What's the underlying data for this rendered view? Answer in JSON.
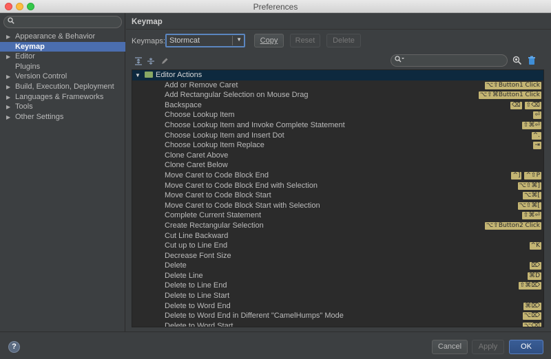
{
  "window": {
    "title": "Preferences"
  },
  "sidebar": {
    "items": [
      {
        "label": "Appearance & Behavior",
        "arrow": "▶",
        "selected": false,
        "child": false
      },
      {
        "label": "Keymap",
        "arrow": "",
        "selected": true,
        "child": true
      },
      {
        "label": "Editor",
        "arrow": "▶",
        "selected": false,
        "child": false
      },
      {
        "label": "Plugins",
        "arrow": "",
        "selected": false,
        "child": true
      },
      {
        "label": "Version Control",
        "arrow": "▶",
        "selected": false,
        "child": false
      },
      {
        "label": "Build, Execution, Deployment",
        "arrow": "▶",
        "selected": false,
        "child": false
      },
      {
        "label": "Languages & Frameworks",
        "arrow": "▶",
        "selected": false,
        "child": false
      },
      {
        "label": "Tools",
        "arrow": "▶",
        "selected": false,
        "child": false
      },
      {
        "label": "Other Settings",
        "arrow": "▶",
        "selected": false,
        "child": false
      }
    ]
  },
  "main": {
    "heading": "Keymap",
    "keymaps_label": "Keymaps:",
    "keymap_selected": "Stormcat",
    "copy_label": "Copy",
    "reset_label": "Reset",
    "delete_label": "Delete"
  },
  "icons": {
    "search": "search-icon",
    "expand_all": "expand-all-icon",
    "collapse_all": "collapse-all-icon",
    "edit": "pencil-icon",
    "find_shortcut": "find-shortcut-icon",
    "clear": "trash-icon",
    "help": "help-icon"
  },
  "tree": {
    "group": "Editor Actions",
    "rows": [
      {
        "name": "Add or Remove Caret",
        "keys": [
          "⌥⇧Button1 Click"
        ]
      },
      {
        "name": "Add Rectangular Selection on Mouse Drag",
        "keys": [
          "⌥⇧⌘Button1 Click"
        ]
      },
      {
        "name": "Backspace",
        "keys": [
          "⌫",
          "⇧⌫"
        ]
      },
      {
        "name": "Choose Lookup Item",
        "keys": [
          "⏎"
        ]
      },
      {
        "name": "Choose Lookup Item and Invoke Complete Statement",
        "keys": [
          "⇧⌘⏎"
        ]
      },
      {
        "name": "Choose Lookup Item and Insert Dot",
        "keys": [
          "^."
        ]
      },
      {
        "name": "Choose Lookup Item Replace",
        "keys": [
          "⇥"
        ]
      },
      {
        "name": "Clone Caret Above",
        "keys": []
      },
      {
        "name": "Clone Caret Below",
        "keys": []
      },
      {
        "name": "Move Caret to Code Block End",
        "keys": [
          "^]",
          "^⇧P"
        ]
      },
      {
        "name": "Move Caret to Code Block End with Selection",
        "keys": [
          "⌥⇧⌘]"
        ]
      },
      {
        "name": "Move Caret to Code Block Start",
        "keys": [
          "⌥⌘["
        ]
      },
      {
        "name": "Move Caret to Code Block Start with Selection",
        "keys": [
          "⌥⇧⌘["
        ]
      },
      {
        "name": "Complete Current Statement",
        "keys": [
          "⇧⌘⏎"
        ]
      },
      {
        "name": "Create Rectangular Selection",
        "keys": [
          "⌥⇧Button2 Click"
        ]
      },
      {
        "name": "Cut Line Backward",
        "keys": []
      },
      {
        "name": "Cut up to Line End",
        "keys": [
          "^K"
        ]
      },
      {
        "name": "Decrease Font Size",
        "keys": []
      },
      {
        "name": "Delete",
        "keys": [
          "⌦"
        ]
      },
      {
        "name": "Delete Line",
        "keys": [
          "⌘D"
        ]
      },
      {
        "name": "Delete to Line End",
        "keys": [
          "⇧⌘⌦"
        ]
      },
      {
        "name": "Delete to Line Start",
        "keys": []
      },
      {
        "name": "Delete to Word End",
        "keys": [
          "⌘⌦"
        ]
      },
      {
        "name": "Delete to Word End in Different \"CamelHumps\" Mode",
        "keys": [
          "⌥⌦"
        ]
      },
      {
        "name": "Delete to Word Start",
        "keys": [
          "⌥⌫"
        ]
      }
    ]
  },
  "footer": {
    "help_label": "?",
    "cancel_label": "Cancel",
    "apply_label": "Apply",
    "ok_label": "OK"
  },
  "colors": {
    "background": "#3c3f41",
    "selection": "#4b6eaf",
    "tree_background": "#2b2b2b",
    "group_row": "#0d293e",
    "shortcut_badge": "#c4b573"
  }
}
